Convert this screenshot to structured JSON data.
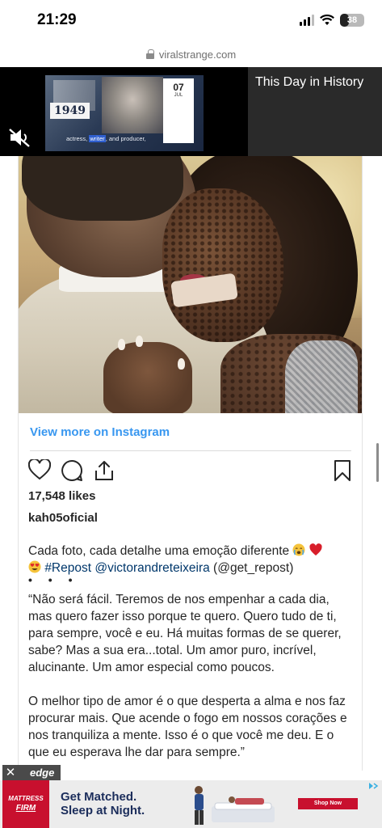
{
  "status_bar": {
    "time": "21:29",
    "battery": "38",
    "battery_level": 0.38
  },
  "browser": {
    "url": "viralstrange.com"
  },
  "video_ad": {
    "year": "1949",
    "day": "07",
    "month": "JUL",
    "caption_before": "actress, ",
    "caption_highlight": "writer",
    "caption_after": ", and producer,",
    "title": "This Day in History",
    "mute_icon": "speaker-muted-icon"
  },
  "instagram_post": {
    "view_more": "View more on Instagram",
    "likes": "17,548 likes",
    "username": "kah05oficial",
    "caption_line1": "Cada foto, cada detalhe uma emoção diferente",
    "repost_tag": "#Repost @victorandreteixeira",
    "repost_handle": "(@get_repost)",
    "ellipsis": "• • •",
    "paragraph1": "“Não será fácil. Teremos de nos empenhar a cada dia, mas quero fazer isso porque te quero. Quero tudo de ti, para sempre, você e eu. Há muitas formas de se querer, sabe? Mas a sua era...total. Um amor puro, incrível, alucinante. Um amor especial como poucos.",
    "paragraph2": "O melhor tipo de amor é o que desperta a alma e nos faz procurar mais. Que acende o fogo em nossos corações e nos tranquiliza a mente. Isso é o que você me deu. E o que eu esperava lhe dar para sempre.”",
    "trailing_dot": "."
  },
  "bottom_ad": {
    "close": "✕",
    "network": "edge",
    "brand_line1": "MATTRESS",
    "brand_line2": "FIRM",
    "headline1": "Get Matched.",
    "headline2": "Sleep at Night.",
    "cta": "Shop Now"
  },
  "colors": {
    "link": "#3897f0",
    "brand_red": "#c8102e",
    "heart_emoji": "#d81e2a"
  }
}
